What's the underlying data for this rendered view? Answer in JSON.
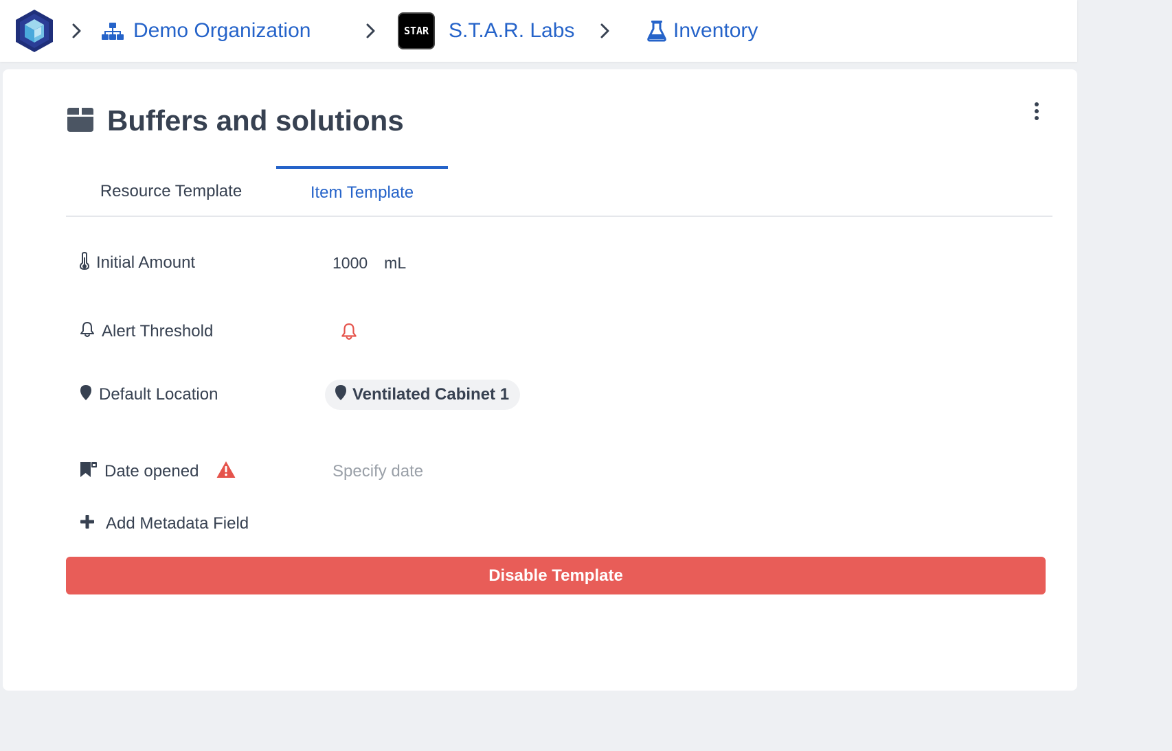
{
  "breadcrumb": {
    "items": [
      {
        "label": "Demo Organization",
        "icon": "sitemap-icon"
      },
      {
        "label": "S.T.A.R. Labs",
        "icon": "star-labs-logo",
        "logo_text": "STAR"
      },
      {
        "label": "Inventory",
        "icon": "flask-icon"
      }
    ],
    "separator_icon": "chevron-right-icon"
  },
  "page": {
    "title": "Buffers and solutions",
    "title_icon": "box-icon",
    "menu_icon": "kebab-menu-icon"
  },
  "tabs": [
    {
      "label": "Resource Template",
      "active": false
    },
    {
      "label": "Item Template",
      "active": true
    }
  ],
  "fields": {
    "initial_amount": {
      "label": "Initial Amount",
      "icon": "thermometer-icon",
      "value": "1000",
      "unit": "mL"
    },
    "alert_threshold": {
      "label": "Alert Threshold",
      "icon": "bell-icon",
      "value_icon": "bell-alert-icon"
    },
    "default_location": {
      "label": "Default Location",
      "icon": "map-pin-icon",
      "value": "Ventilated Cabinet 1"
    },
    "date_opened": {
      "label": "Date opened",
      "icon": "bookmark-calendar-icon",
      "warning_icon": "warning-icon",
      "placeholder": "Specify date"
    }
  },
  "actions": {
    "add_metadata_label": "Add Metadata Field",
    "disable_template_label": "Disable Template"
  },
  "colors": {
    "link": "#2563c9",
    "text": "#374151",
    "danger": "#e85d58",
    "warning": "#e5534b"
  }
}
